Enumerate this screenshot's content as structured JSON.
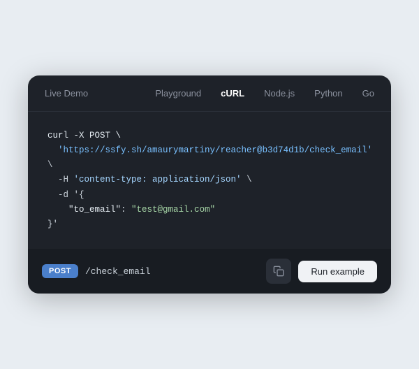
{
  "nav": {
    "live_demo": "Live Demo",
    "playground": "Playground",
    "curl": "cURL",
    "nodejs": "Node.js",
    "python": "Python",
    "go": "Go",
    "active_tab": "curl"
  },
  "code": {
    "line1": "curl -X POST \\",
    "line2": "  'https://ssfy.sh/amaurymartiny/reacher@b3d74d1b/check_email' \\",
    "line3": "  -H 'content-type: application/json' \\",
    "line4": "  -d '{",
    "line5": "  \"to_email\": \"test@gmail.com\"",
    "line6": "}'"
  },
  "footer": {
    "method": "POST",
    "endpoint": "/check_email",
    "copy_icon": "⧉",
    "run_label": "Run example"
  }
}
